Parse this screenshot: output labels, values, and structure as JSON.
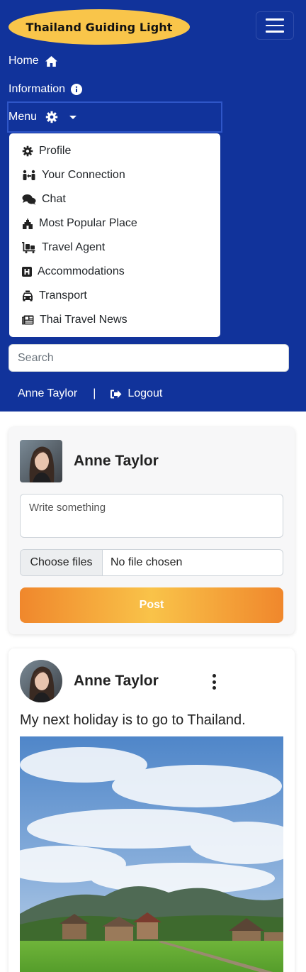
{
  "brand": {
    "title": "Thailand Guiding Light"
  },
  "nav": {
    "home": "Home",
    "information": "Information",
    "menu": "Menu"
  },
  "dropdown": {
    "items": [
      {
        "label": "Profile",
        "icon": "gear-icon"
      },
      {
        "label": "Your Connection",
        "icon": "people-arrows-icon"
      },
      {
        "label": "Chat",
        "icon": "comments-icon"
      },
      {
        "label": "Most Popular Place",
        "icon": "place-icon"
      },
      {
        "label": "Travel Agent",
        "icon": "luggage-cart-icon"
      },
      {
        "label": "Accommodations",
        "icon": "hotel-icon"
      },
      {
        "label": "Transport",
        "icon": "taxi-icon"
      },
      {
        "label": "Thai Travel News",
        "icon": "newspaper-icon"
      }
    ]
  },
  "search": {
    "placeholder": "Search"
  },
  "user_bar": {
    "name": "Anne Taylor",
    "separator": "|",
    "logout": "Logout"
  },
  "composer": {
    "user_name": "Anne Taylor",
    "textarea_placeholder": "Write something",
    "choose_files": "Choose files",
    "no_file": "No file chosen",
    "post_button": "Post"
  },
  "post": {
    "user_name": "Anne Taylor",
    "text": "My next holiday is to go to Thailand."
  },
  "colors": {
    "navbar": "#11339b",
    "brand_bg": "#f9c54a",
    "post_gradient_start": "#f0872c",
    "post_gradient_mid": "#f9c349"
  }
}
